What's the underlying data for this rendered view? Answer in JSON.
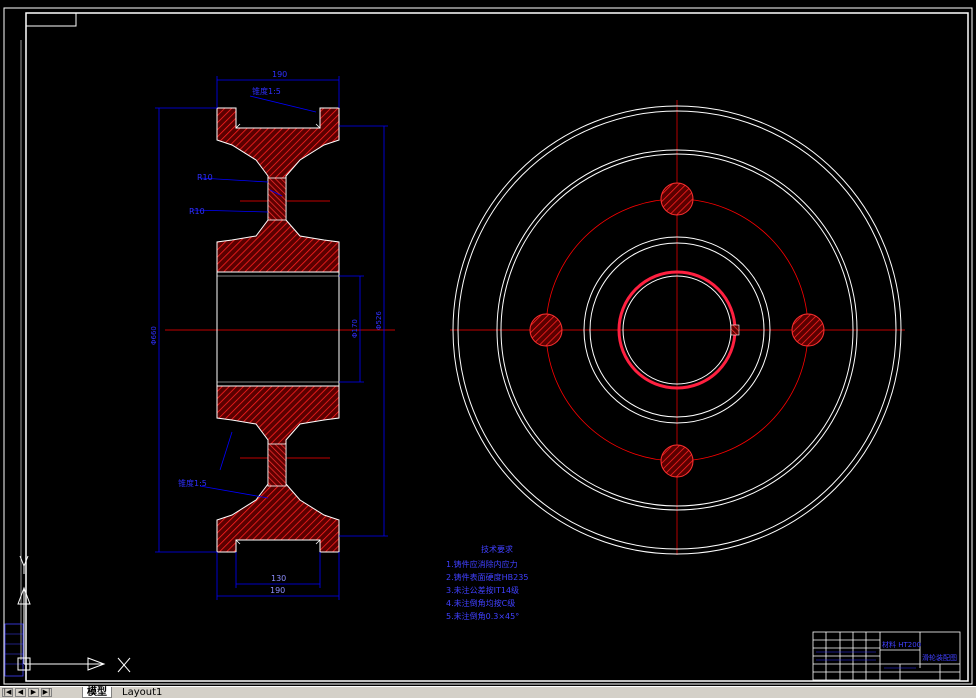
{
  "drawing": {
    "dims": {
      "d190_top": "190",
      "d190_bottom": "190",
      "d130": "130",
      "r10_a": "R10",
      "r10_b": "R10",
      "phi_outer": "Φ660",
      "phi_mid": "Φ526",
      "phi_bore": "Φ170",
      "chamfer_top": "锥度1:5",
      "chamfer_bottom": "锥度1:5"
    },
    "tech_requirements": {
      "title": "技术要求",
      "items": [
        "1.铸件应消除内应力",
        "2.铸件表面硬度HB235",
        "3.未注公差按IT14级",
        "4.未注倒角均按C级",
        "5.未注倒角0.3×45°"
      ]
    },
    "title_block": {
      "material": "材料 HT200",
      "name": "滑轮装配图"
    },
    "ucs": {
      "x": "X",
      "y": "Y"
    }
  },
  "layout_tabs": {
    "nav_buttons": [
      "|◀",
      "◀",
      "▶",
      "▶|"
    ],
    "tabs": [
      "模型",
      "Layout1"
    ],
    "active_tab": "模型"
  },
  "colors": {
    "background": "#000000",
    "outline": "#ffffff",
    "section": "#ff0000",
    "dimension": "#0000ff"
  }
}
